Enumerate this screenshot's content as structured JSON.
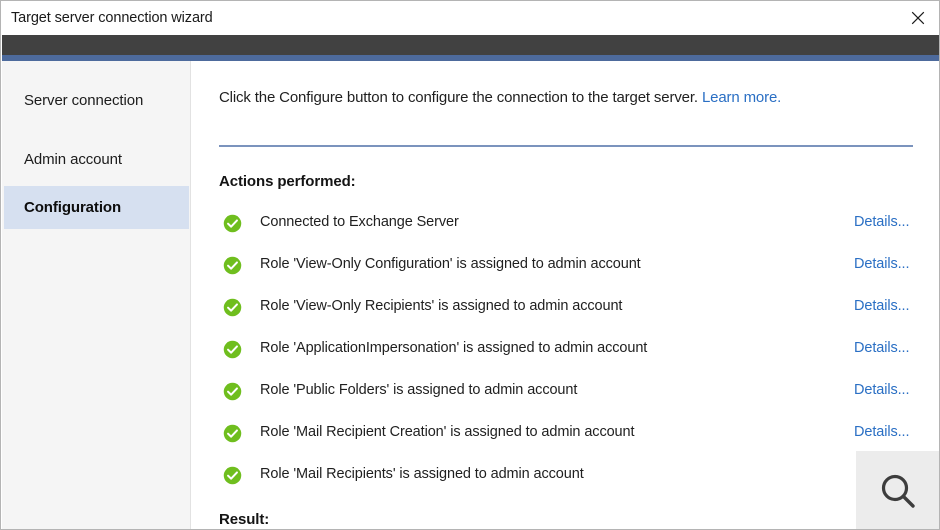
{
  "window": {
    "title": "Target server connection wizard",
    "close_label": "Close",
    "accent_color": "#4d6a9c",
    "header_color": "#414141"
  },
  "sidebar": {
    "items": [
      {
        "label": "Server connection",
        "selected": false
      },
      {
        "label": "Admin account",
        "selected": false
      },
      {
        "label": "Configuration",
        "selected": true
      }
    ]
  },
  "content": {
    "intro_text": "Click the Configure button to configure the connection to the target server.",
    "learn_more_label": "Learn more.",
    "actions_heading": "Actions performed:",
    "result_heading": "Result:",
    "details_label": "Details...",
    "status_icon_color": "#6fbe1e",
    "link_color": "#2a6fc4",
    "actions": [
      {
        "status": "success",
        "label": "Connected to Exchange Server",
        "has_details": true
      },
      {
        "status": "success",
        "label": "Role 'View-Only Configuration' is assigned to admin account",
        "has_details": true
      },
      {
        "status": "success",
        "label": "Role 'View-Only Recipients' is assigned to admin account",
        "has_details": true
      },
      {
        "status": "success",
        "label": "Role 'ApplicationImpersonation' is assigned to admin account",
        "has_details": true
      },
      {
        "status": "success",
        "label": "Role 'Public Folders' is assigned to admin account",
        "has_details": true
      },
      {
        "status": "success",
        "label": "Role 'Mail Recipient Creation' is assigned to admin account",
        "has_details": true
      },
      {
        "status": "success",
        "label": "Role 'Mail Recipients' is assigned to admin account",
        "has_details": false
      }
    ]
  },
  "overlay": {
    "magnifier_icon": "search-icon"
  }
}
